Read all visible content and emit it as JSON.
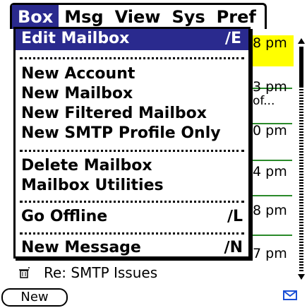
{
  "menubar": {
    "menus": [
      "Box",
      "Msg",
      "View",
      "Sys",
      "Pref"
    ],
    "active_index": 0
  },
  "dropdown": {
    "items": [
      {
        "label": "Edit Mailbox",
        "shortcut": "∕E",
        "selected": true
      },
      {
        "label": "New Account",
        "shortcut": ""
      },
      {
        "label": "New Mailbox",
        "shortcut": ""
      },
      {
        "label": "New Filtered Mailbox",
        "shortcut": ""
      },
      {
        "label": "New SMTP Profile Only",
        "shortcut": ""
      },
      {
        "label": "Delete Mailbox",
        "shortcut": ""
      },
      {
        "label": "Mailbox Utilities",
        "shortcut": ""
      },
      {
        "label": "Go Offline",
        "shortcut": "∕L"
      },
      {
        "label": "New Message",
        "shortcut": "∕N"
      }
    ]
  },
  "background_list": {
    "times": [
      "8 pm",
      "3 pm",
      "of...",
      "0 pm",
      "4 pm",
      "8 pm",
      "7 pm"
    ]
  },
  "message_row": {
    "subject": "Re: SMTP Issues",
    "icon": "trash-envelope-icon"
  },
  "bottom_bar": {
    "new_label": "New",
    "mail_icon": "envelope-icon"
  },
  "colors": {
    "menu_highlight": "#2a2a8e",
    "time_highlight": "#ffff00",
    "accent_green": "#2a8a2a",
    "mail_icon": "#1a4fd6"
  }
}
